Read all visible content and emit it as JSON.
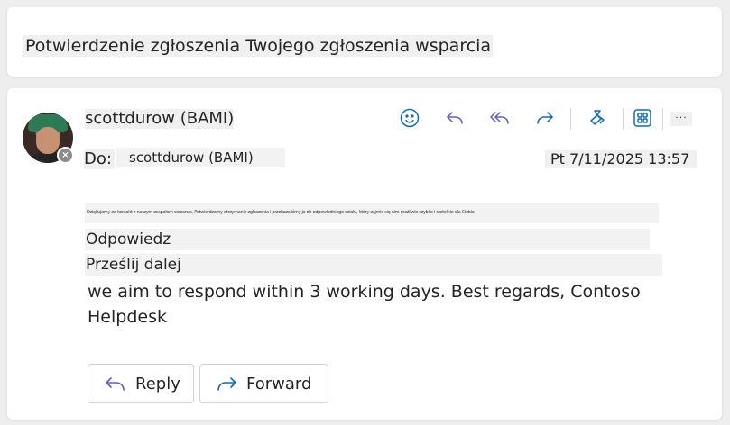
{
  "subject": "Potwierdzenie zgłoszenia Twojego zgłoszenia wsparcia",
  "sender": {
    "name": "scottdurow (BAMI)"
  },
  "toolbar": {
    "icons": [
      "emoji-icon",
      "reply-icon",
      "reply-all-icon",
      "forward-icon",
      "copilot-icon",
      "apps-icon"
    ],
    "more_label": "..."
  },
  "recipients": {
    "label": "Do:",
    "value": "scottdurow (BAMI)"
  },
  "date": "Pt 7/11/2025 13:57",
  "body": {
    "garbled_line": "Dziękujemy za kontakt z naszym zespołem wsparcia. Potwierdzamy otrzymanie zgłoszenia i przekazaliśmy je do odpowiedniego działu, który zajmie się nim możliwie szybko i rzetelnie dla Ciebie",
    "line_reply": "Odpowiedz",
    "line_forward": "Prześlij dalej",
    "text": "we aim to respond within 3 working days. Best regards, Contoso Helpdesk"
  },
  "buttons": {
    "reply": "Reply",
    "forward": "Forward"
  },
  "colors": {
    "accent": "#5b5fc7",
    "icon_blue": "#0f6cbd",
    "background": "#eeeeee"
  }
}
